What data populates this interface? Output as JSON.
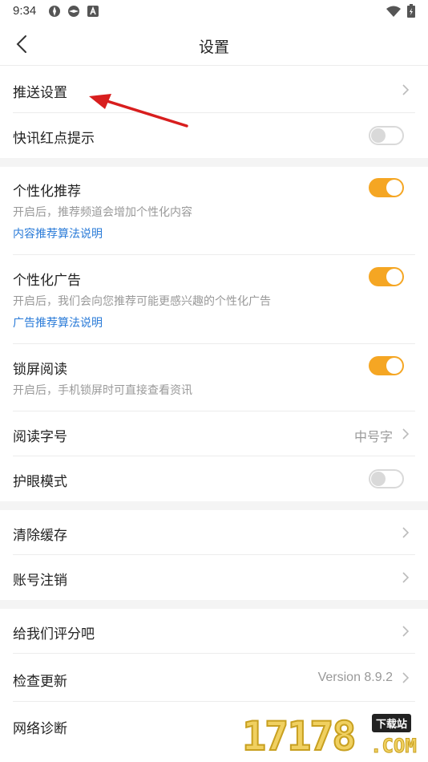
{
  "status_bar": {
    "time": "9:34"
  },
  "header": {
    "title": "设置"
  },
  "rows": {
    "push": {
      "title": "推送设置"
    },
    "flash_dot": {
      "title": "快讯红点提示",
      "enabled": false
    },
    "personalized_rec": {
      "title": "个性化推荐",
      "desc": "开启后，推荐频道会增加个性化内容",
      "link": "内容推荐算法说明",
      "enabled": true
    },
    "personalized_ad": {
      "title": "个性化广告",
      "desc": "开启后，我们会向您推荐可能更感兴趣的个性化广告",
      "link": "广告推荐算法说明",
      "enabled": true
    },
    "lock_read": {
      "title": "锁屏阅读",
      "desc": "开启后，手机锁屏时可直接查看资讯",
      "enabled": true
    },
    "font_size": {
      "title": "阅读字号",
      "value": "中号字"
    },
    "eye_mode": {
      "title": "护眼模式",
      "enabled": false
    },
    "clear_cache": {
      "title": "清除缓存"
    },
    "cancel_account": {
      "title": "账号注销"
    },
    "rate": {
      "title": "给我们评分吧"
    },
    "update": {
      "title": "检查更新",
      "value": "Version 8.9.2"
    },
    "network": {
      "title": "网络诊断"
    }
  },
  "watermark": {
    "number": "17178",
    "badge": "下载站",
    "domain": ".COM"
  },
  "colors": {
    "accent": "#f5a623",
    "link": "#2a7bd8",
    "arrow": "#d81e1e"
  }
}
